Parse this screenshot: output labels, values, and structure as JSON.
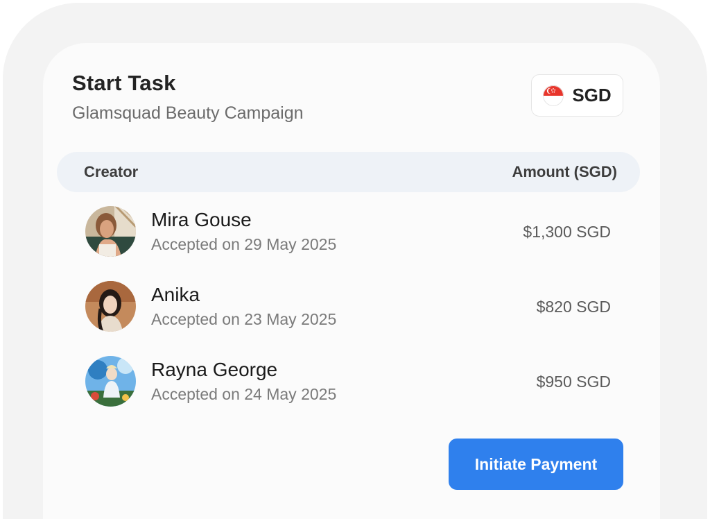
{
  "header": {
    "title": "Start Task",
    "subtitle": "Glamsquad Beauty Campaign"
  },
  "currency": {
    "label": "SGD",
    "flag_icon": "singapore-flag-icon",
    "flag_colors": [
      "#e8352b",
      "#ffffff"
    ]
  },
  "table": {
    "columns": [
      "Creator",
      "Amount (SGD)"
    ],
    "rows": [
      {
        "name": "Mira Gouse",
        "accepted": "Accepted on 29 May 2025",
        "amount": "$1,300 SGD"
      },
      {
        "name": "Anika",
        "accepted": "Accepted on 23 May 2025",
        "amount": "$820 SGD"
      },
      {
        "name": "Rayna George",
        "accepted": "Accepted on 24 May 2025",
        "amount": "$950 SGD"
      }
    ]
  },
  "action": {
    "label": "Initiate Payment",
    "color": "#2f80ed"
  }
}
